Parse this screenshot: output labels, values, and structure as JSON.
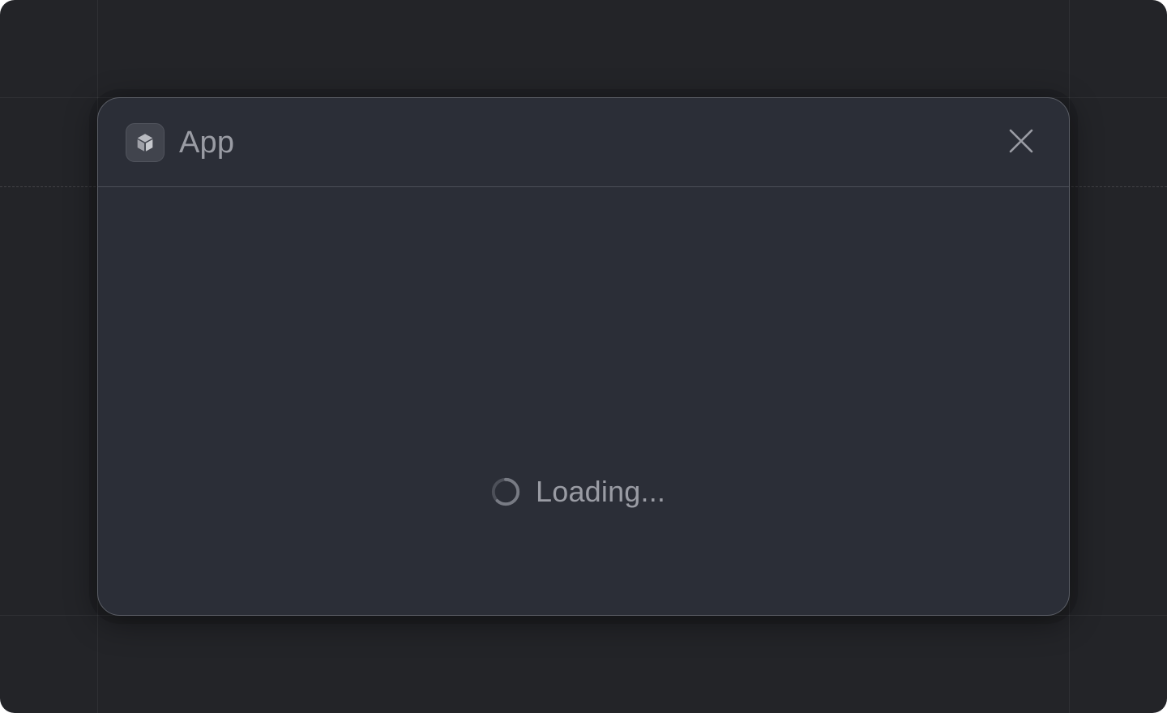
{
  "dialog": {
    "title": "App",
    "app_icon": "cube-icon",
    "close_icon": "close-icon"
  },
  "body": {
    "loading_text": "Loading...",
    "spinner_icon": "spinner-icon"
  },
  "colors": {
    "background": "#232428",
    "dialog_surface": "#2b2e37",
    "dialog_border": "#5b5e66",
    "text_muted": "#9a9ca4"
  }
}
